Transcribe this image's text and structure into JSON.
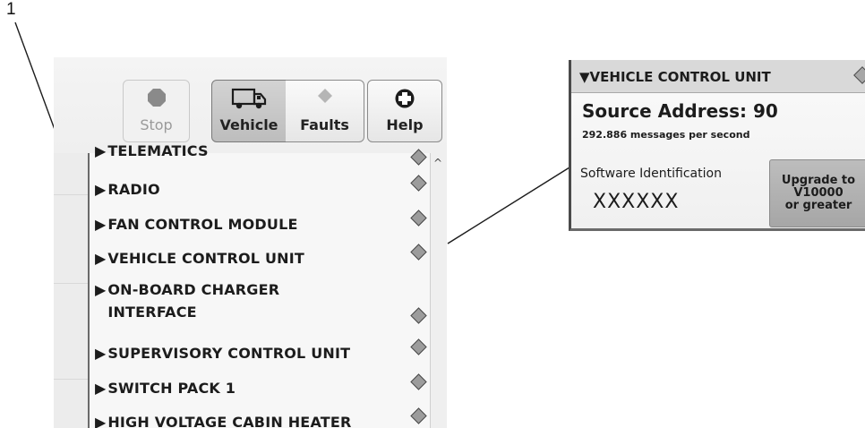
{
  "callout": {
    "number": "1"
  },
  "toolbar": {
    "stop_label": "Stop",
    "vehicle_label": "Vehicle",
    "faults_label": "Faults",
    "help_label": "Help"
  },
  "list": {
    "partial_top": "TELEMATICS",
    "items": [
      {
        "label": "RADIO"
      },
      {
        "label": "FAN CONTROL MODULE"
      },
      {
        "label": "VEHICLE CONTROL UNIT"
      },
      {
        "label_line1": "ON-BOARD CHARGER",
        "label_line2": "INTERFACE"
      },
      {
        "label": "SUPERVISORY CONTROL UNIT"
      },
      {
        "label": "SWITCH PACK 1"
      },
      {
        "label": "HIGH VOLTAGE CABIN HEATER"
      }
    ]
  },
  "panel": {
    "title": "VEHICLE CONTROL UNIT",
    "source_address": "Source Address: 90",
    "message_rate": "292.886 messages per second",
    "software_label": "Software Identification",
    "software_value": "XXXXXX",
    "upgrade_line1": "Upgrade to",
    "upgrade_line2": "V10000",
    "upgrade_line3": "or greater"
  },
  "icons": {
    "stop": "stop-octagon-icon",
    "vehicle": "truck-icon",
    "faults": "diamond-icon",
    "help": "cross-circle-icon",
    "status": "status-diamond-icon"
  },
  "colors": {
    "status_diamond_fill": "#9c9c9c",
    "upgrade_button": "#b0b0b0",
    "active_tab": "#c8c8c8"
  }
}
